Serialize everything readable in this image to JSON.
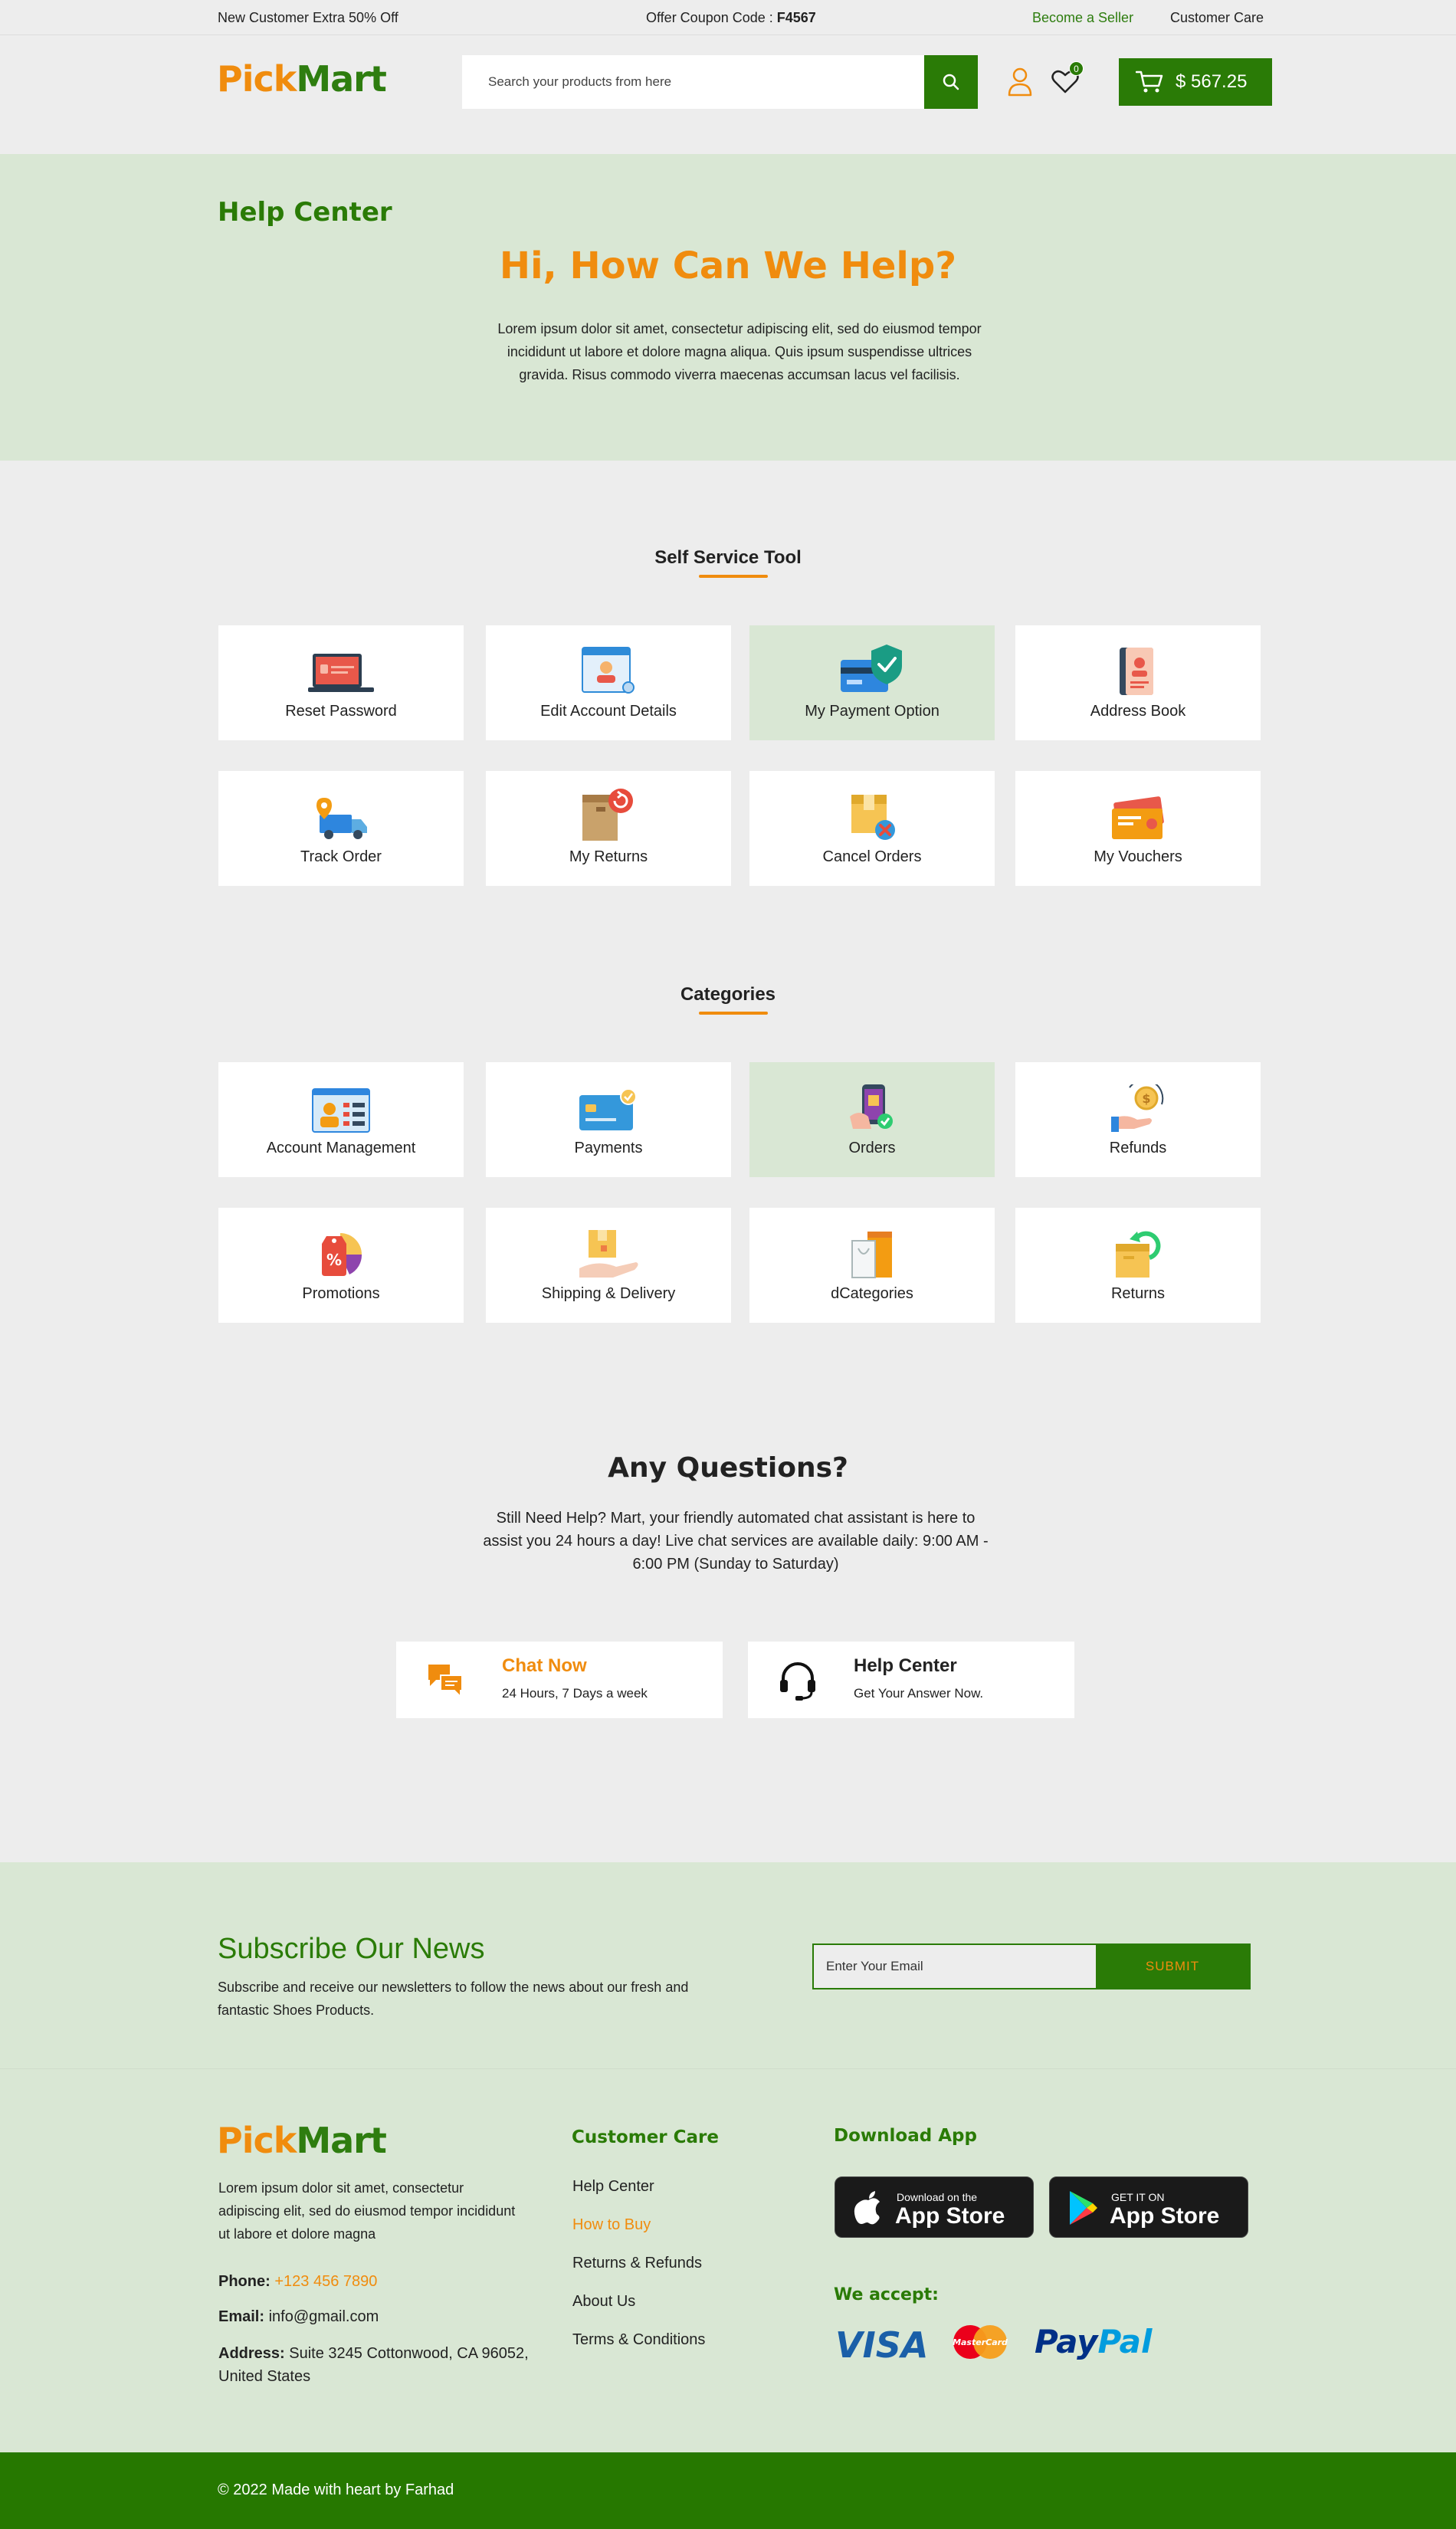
{
  "topbar": {
    "promo": "New Customer Extra 50% Off",
    "coupon_label": "Offer Coupon Code : ",
    "coupon_code": "F4567",
    "become_seller": "Become a Seller",
    "customer_care": "Customer Care"
  },
  "brand": {
    "part1": "Pick",
    "part2": "Mart",
    "color_orange": "#f08c0e",
    "color_green": "#2a7b06"
  },
  "header": {
    "search_placeholder": "Search your products from here",
    "wishlist_count": "0",
    "cart_total": "$ 567.25"
  },
  "hero": {
    "section_label": "Help Center",
    "heading": "Hi, How Can We Help?",
    "text": "Lorem ipsum dolor sit amet, consectetur adipiscing elit, sed do eiusmod tempor incididunt ut labore et dolore magna aliqua. Quis ipsum suspendisse ultrices gravida. Risus commodo viverra maecenas accumsan lacus vel facilisis."
  },
  "self_service": {
    "title": "Self Service Tool",
    "items": [
      {
        "label": "Reset Password",
        "icon": "laptop-password-icon"
      },
      {
        "label": "Edit Account Details",
        "icon": "account-details-icon"
      },
      {
        "label": "My Payment Option",
        "icon": "card-shield-icon",
        "active": true
      },
      {
        "label": "Address Book",
        "icon": "address-book-icon"
      },
      {
        "label": "Track Order",
        "icon": "delivery-truck-icon"
      },
      {
        "label": "My Returns",
        "icon": "return-box-icon"
      },
      {
        "label": "Cancel Orders",
        "icon": "cancel-box-icon"
      },
      {
        "label": "My Vouchers",
        "icon": "voucher-icon"
      }
    ]
  },
  "categories": {
    "title": "Categories",
    "items": [
      {
        "label": "Account Management",
        "icon": "account-management-icon"
      },
      {
        "label": "Payments",
        "icon": "payment-card-icon"
      },
      {
        "label": "Orders",
        "icon": "phone-order-icon",
        "active": true
      },
      {
        "label": "Refunds",
        "icon": "refund-coin-icon"
      },
      {
        "label": "Promotions",
        "icon": "promotion-tag-icon"
      },
      {
        "label": "Shipping & Delivery",
        "icon": "shipping-box-icon"
      },
      {
        "label": "dCategories",
        "icon": "shopping-bag-icon"
      },
      {
        "label": "Returns",
        "icon": "returns-box-icon"
      }
    ]
  },
  "questions": {
    "title": "Any Questions?",
    "text": "Still Need Help? Mart, your friendly automated chat assistant is here to assist you 24 hours a day! Live chat services are available daily: 9:00 AM - 6:00 PM (Sunday to Saturday)",
    "chat": {
      "title": "Chat Now",
      "subtitle": "24 Hours, 7 Days a week",
      "icon": "chat-icon"
    },
    "help": {
      "title": "Help Center",
      "subtitle": "Get Your Answer Now.",
      "icon": "headset-icon"
    }
  },
  "subscribe": {
    "title": "Subscribe Our News",
    "text": "Subscribe and receive our newsletters to follow the news about our fresh and fantastic Shoes Products.",
    "placeholder": "Enter Your Email",
    "button": "SUBMIT"
  },
  "footer": {
    "about": "Lorem ipsum dolor sit amet, consectetur adipiscing elit, sed do eiusmod tempor incididunt ut labore et dolore magna",
    "phone_label": "Phone:",
    "phone": "+123 456 7890",
    "email_label": "Email:",
    "email": "info@gmail.com",
    "address_label": "Address:",
    "address": "Suite 3245 Cottonwood, CA 96052, United States",
    "customer_care_title": "Customer Care",
    "links": [
      "Help Center",
      "How to Buy",
      "Returns & Refunds",
      "About Us",
      "Terms & Conditions"
    ],
    "download_title": "Download App",
    "apple": {
      "small": "Download on the",
      "big": "App Store"
    },
    "google": {
      "small": "GET IT ON",
      "big": "App Store"
    },
    "accept_title": "We accept:",
    "payments": {
      "visa": "VISA",
      "mastercard": "MasterCard",
      "paypal_a": "Pay",
      "paypal_b": "Pal"
    },
    "copyright": "© 2022 Made with heart by Farhad"
  }
}
